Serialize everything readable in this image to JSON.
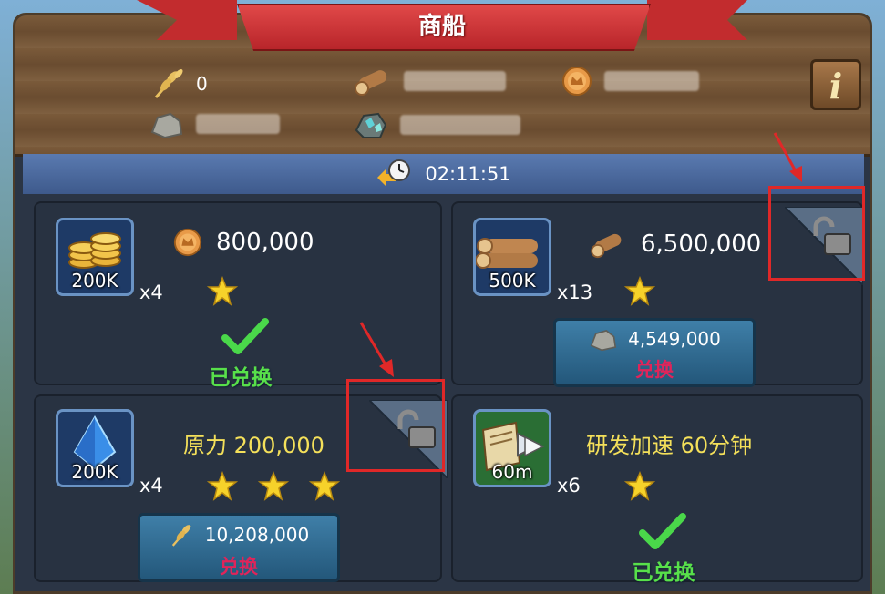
{
  "header": {
    "title": "商船"
  },
  "resources": {
    "wheat": {
      "value": "0",
      "icon": "wheat-icon"
    },
    "wood": {
      "value": "",
      "icon": "log-icon"
    },
    "gold": {
      "value": "",
      "icon": "gold-coin-icon"
    },
    "stone": {
      "value": "",
      "icon": "stone-icon"
    },
    "ore": {
      "value": "",
      "icon": "ore-icon"
    }
  },
  "info_button": {
    "label": "i"
  },
  "timer": {
    "value": "02:11:51"
  },
  "offers": [
    {
      "thumb_amount": "200K",
      "multiplier": "x4",
      "cost": "800,000",
      "cost_icon": "gold-coin-icon",
      "stars": 1,
      "status": "已兑换"
    },
    {
      "thumb_amount": "500K",
      "multiplier": "x13",
      "cost": "6,500,000",
      "cost_icon": "log-icon",
      "stars": 1,
      "button_cost": "4,549,000",
      "button_icon": "stone-icon",
      "button_label": "兑换"
    },
    {
      "thumb_amount": "200K",
      "multiplier": "x4",
      "title": "原力 200,000",
      "stars": 3,
      "button_cost": "10,208,000",
      "button_icon": "wheat-icon",
      "button_label": "兑换"
    },
    {
      "thumb_amount": "60m",
      "multiplier": "x6",
      "title": "研发加速 60分钟",
      "stars": 1,
      "status": "已兑换"
    }
  ],
  "colors": {
    "highlight": "#e02828",
    "done_text": "#58e04a",
    "exchange_text": "#e0245a",
    "title_text": "#f4e05a"
  }
}
